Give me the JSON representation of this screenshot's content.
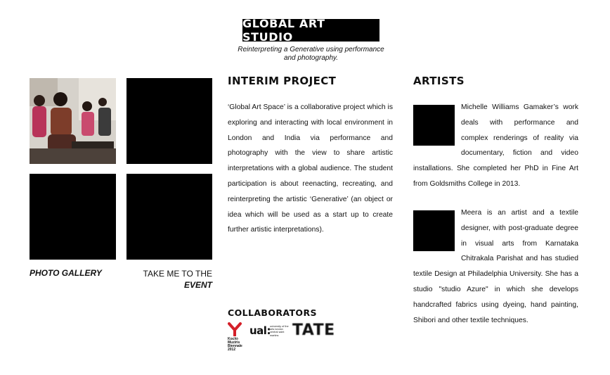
{
  "header": {
    "title": "GLOBAL ART STUDIO",
    "subtitle_line1": "Reinterpreting a Generative using performance",
    "subtitle_line2": "and photography."
  },
  "gallery": {
    "photo_gallery_label": "PHOTO GALLERY",
    "event_link_line1": "TAKE ME TO THE",
    "event_link_line2": "EVENT"
  },
  "interim": {
    "heading": "INTERIM PROJECT",
    "body": "‘Global Art Space’ is a collaborative project which is exploring and interacting with local environment in London and India via performance and photography with the view to share artistic interpretations with a global audience. The student participation is about reenacting, recreating, and reinterpreting the artistic ‘Generative’ (an object or idea which will be used as a start up to create further artistic interpretations)."
  },
  "artists": {
    "heading": "ARTISTS",
    "items": [
      {
        "bio": "Michelle Williams Gamaker’s work deals with performance and complex renderings of reality via documentary, fiction and video installations. She completed her PhD in Fine Art from Goldsmiths College in 2013."
      },
      {
        "bio": "Meera is an artist and a textile designer, with post-graduate degree in visual arts from Karnataka Chitrakala Parishat and has studied textile Design at Philadelphia University. She has a studio \"studio Azure\" in which she develops handcrafted fabrics using dyeing, hand painting, Shibori and other textile techniques."
      }
    ]
  },
  "collaborators": {
    "heading": "COLLABORATORS",
    "kochi_text": "Kochi-Muziris Biennale 2012",
    "ual_main": "ual:",
    "ual_sub": "university of the arts london central saint martins",
    "tate": "TATE"
  },
  "colors": {
    "kochi_red": "#d4202a",
    "tile": "#000000"
  }
}
